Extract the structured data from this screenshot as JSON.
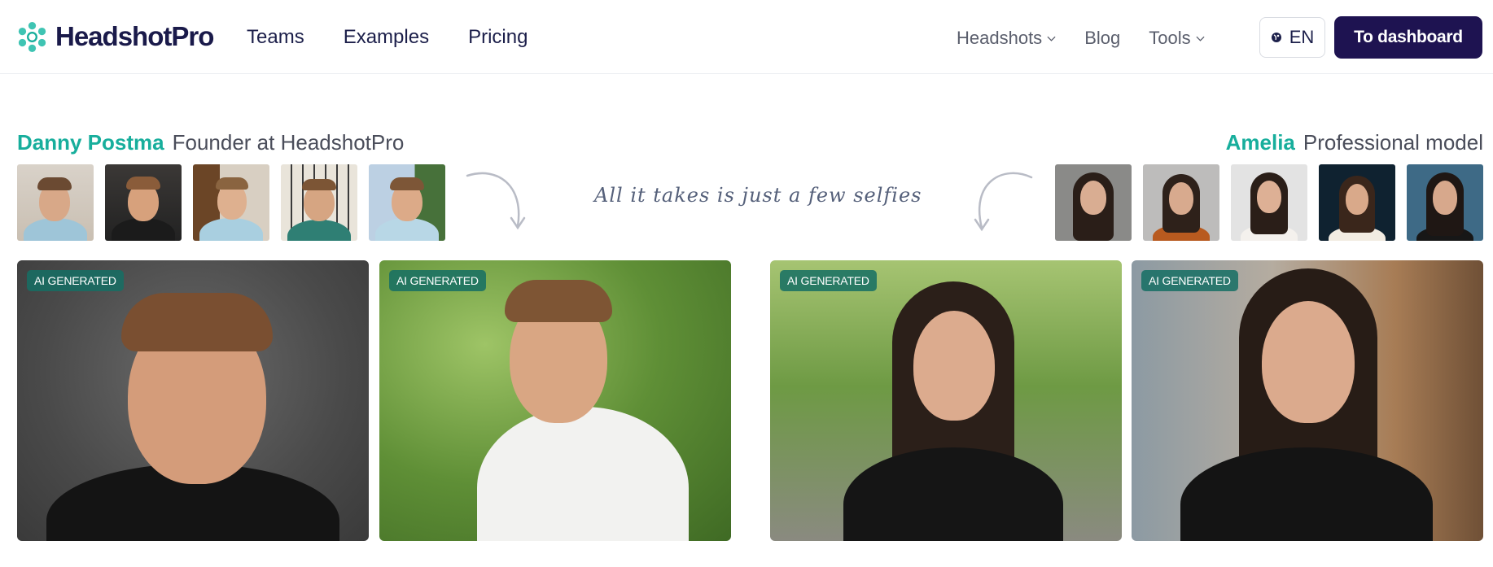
{
  "header": {
    "brand": "HeadshotPro",
    "nav_main": [
      "Teams",
      "Examples",
      "Pricing"
    ],
    "nav_right": [
      {
        "label": "Headshots",
        "has_dropdown": true
      },
      {
        "label": "Blog",
        "has_dropdown": false
      },
      {
        "label": "Tools",
        "has_dropdown": true
      }
    ],
    "language": "EN",
    "cta": "To dashboard"
  },
  "left_person": {
    "name": "Danny Postma",
    "role": "Founder at HeadshotPro"
  },
  "right_person": {
    "name": "Amelia",
    "role": "Professional model"
  },
  "caption": "All it takes is just a few selfies",
  "badge_label": "AI GENERATED",
  "colors": {
    "brand_teal": "#17ae9c",
    "cta_navy": "#1e1351",
    "badge_green": "#156e64"
  }
}
